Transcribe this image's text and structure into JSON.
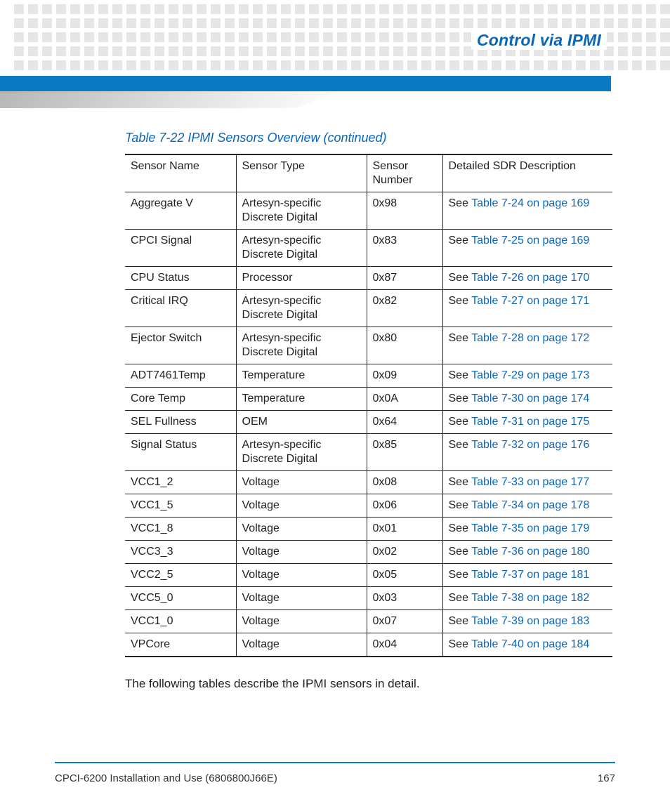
{
  "header": {
    "chapter_title": "Control via IPMI"
  },
  "table": {
    "caption": "Table 7-22 IPMI Sensors Overview (continued)",
    "headers": {
      "sensor_name": "Sensor Name",
      "sensor_type": "Sensor Type",
      "sensor_number": "Sensor Number",
      "detailed_sdr": "Detailed SDR Description"
    },
    "see_prefix": "See ",
    "rows": [
      {
        "name": "Aggregate V",
        "type": "Artesyn-specific Discrete Digital",
        "number": "0x98",
        "link": "Table 7-24 on page 169"
      },
      {
        "name": "CPCI Signal",
        "type": "Artesyn-specific Discrete Digital",
        "number": "0x83",
        "link": "Table 7-25 on page 169"
      },
      {
        "name": "CPU Status",
        "type": "Processor",
        "number": "0x87",
        "link": "Table 7-26 on page 170"
      },
      {
        "name": "Critical IRQ",
        "type": "Artesyn-specific Discrete Digital",
        "number": "0x82",
        "link": "Table 7-27 on page 171"
      },
      {
        "name": "Ejector Switch",
        "type": "Artesyn-specific Discrete Digital",
        "number": "0x80",
        "link": "Table 7-28 on page 172"
      },
      {
        "name": "ADT7461Temp",
        "type": "Temperature",
        "number": "0x09",
        "link": "Table 7-29 on page 173"
      },
      {
        "name": "Core Temp",
        "type": "Temperature",
        "number": "0x0A",
        "link": "Table 7-30 on page 174"
      },
      {
        "name": "SEL Fullness",
        "type": "OEM",
        "number": "0x64",
        "link": "Table 7-31 on page 175"
      },
      {
        "name": "Signal Status",
        "type": "Artesyn-specific Discrete Digital",
        "number": "0x85",
        "link": "Table 7-32 on page 176"
      },
      {
        "name": "VCC1_2",
        "type": "Voltage",
        "number": "0x08",
        "link": "Table 7-33 on page 177"
      },
      {
        "name": "VCC1_5",
        "type": "Voltage",
        "number": "0x06",
        "link": "Table 7-34 on page 178"
      },
      {
        "name": "VCC1_8",
        "type": "Voltage",
        "number": "0x01",
        "link": "Table 7-35 on page 179"
      },
      {
        "name": "VCC3_3",
        "type": "Voltage",
        "number": "0x02",
        "link": "Table 7-36 on page 180"
      },
      {
        "name": "VCC2_5",
        "type": "Voltage",
        "number": "0x05",
        "link": "Table 7-37 on page 181"
      },
      {
        "name": "VCC5_0",
        "type": "Voltage",
        "number": "0x03",
        "link": "Table 7-38 on page 182"
      },
      {
        "name": "VCC1_0",
        "type": "Voltage",
        "number": "0x07",
        "link": "Table 7-39 on page 183"
      },
      {
        "name": "VPCore",
        "type": "Voltage",
        "number": "0x04",
        "link": "Table 7-40 on page 184"
      }
    ]
  },
  "body_text": "The following tables describe the IPMI sensors in detail.",
  "footer": {
    "doc_title": "CPCI-6200 Installation and Use (6806800J66E)",
    "page_number": "167"
  }
}
